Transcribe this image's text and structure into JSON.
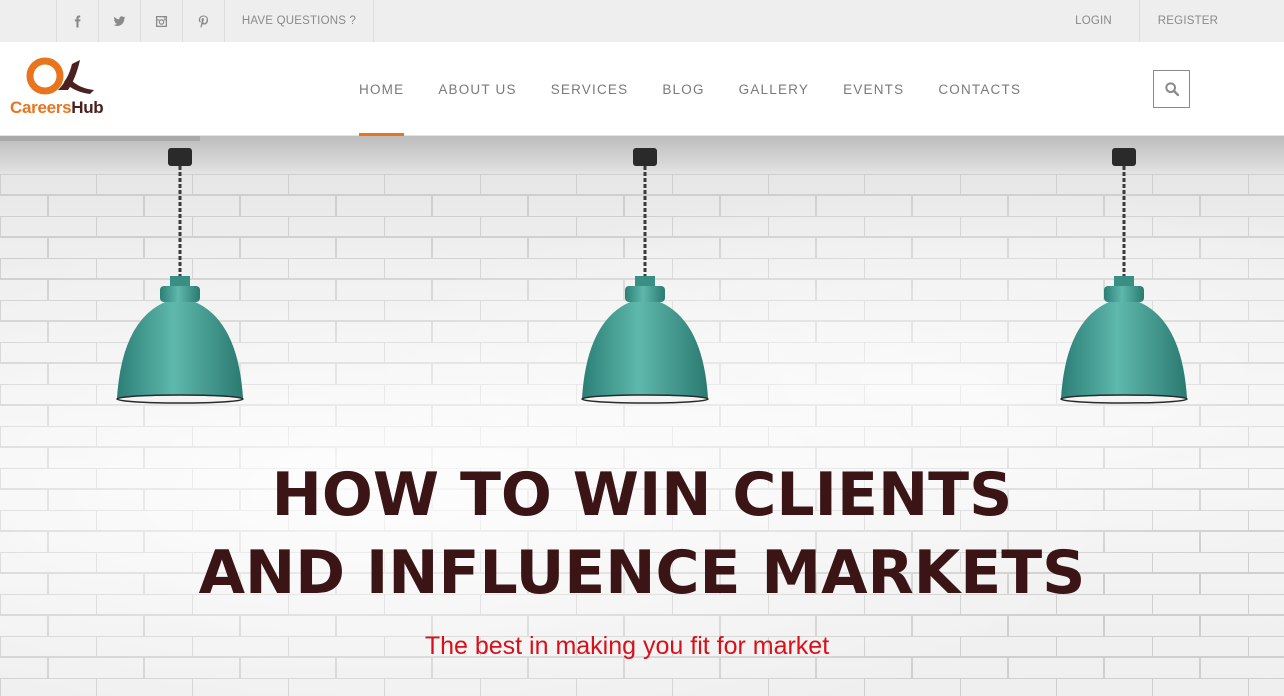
{
  "topbar": {
    "social": [
      {
        "name": "facebook-icon"
      },
      {
        "name": "twitter-icon"
      },
      {
        "name": "instagram-icon"
      },
      {
        "name": "pinterest-icon"
      }
    ],
    "question_label": "HAVE QUESTIONS ?",
    "login_label": "LOGIN",
    "register_label": "REGISTER"
  },
  "header": {
    "logo": {
      "part1": "Careers",
      "part2": "Hub"
    },
    "nav": [
      "HOME",
      "ABOUT US",
      "SERVICES",
      "BLOG",
      "GALLERY",
      "EVENTS",
      "CONTACTS"
    ],
    "active_nav": "HOME",
    "search_icon": "search-icon"
  },
  "hero": {
    "headline_line1": "HOW TO WIN CLIENTS",
    "headline_line2": "AND INFLUENCE MARKETS",
    "tagline": "The best in making you fit for market"
  },
  "colors": {
    "accent": "#e8741e",
    "headline": "#3b1416",
    "tagline": "#d8101a",
    "lamp": "#3a9a8f"
  }
}
